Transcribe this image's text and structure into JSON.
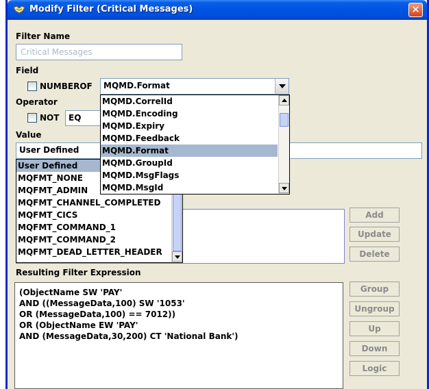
{
  "window": {
    "title": "Modify Filter (Critical Messages)",
    "close_glyph": "✕"
  },
  "filter_name": {
    "label": "Filter Name",
    "placeholder": "Critical Messages"
  },
  "field": {
    "label": "Field",
    "numberof_label": "NUMBEROF",
    "numberof_checked": false,
    "selected": "MQMD.Format",
    "options": [
      "MQMD.CorrelId",
      "MQMD.Encoding",
      "MQMD.Expiry",
      "MQMD.Feedback",
      "MQMD.Format",
      "MQMD.GroupId",
      "MQMD.MsgFlags",
      "MQMD.MsgId"
    ]
  },
  "operator": {
    "label": "Operator",
    "not_label": "NOT",
    "not_checked": false,
    "selected": "EQ"
  },
  "value": {
    "label": "Value",
    "selected": "User Defined",
    "input": "",
    "options": [
      "User Defined",
      "MQFMT_NONE",
      "MQFMT_ADMIN",
      "MQFMT_CHANNEL_COMPLETED",
      "MQFMT_CICS",
      "MQFMT_COMMAND_1",
      "MQFMT_COMMAND_2",
      "MQFMT_DEAD_LETTER_HEADER"
    ]
  },
  "side_buttons": {
    "add": "Add",
    "update": "Update",
    "delete": "Delete",
    "group": "Group",
    "ungroup": "Ungroup",
    "up": "Up",
    "down": "Down",
    "logic": "Logic"
  },
  "resulting": {
    "label": "Resulting Filter Expression",
    "lines": [
      "(ObjectName SW 'PAY'",
      "AND ((MessageData,100) SW '1053'",
      "OR (MessageData,100) == 7012))",
      "OR (ObjectName EW 'PAY'",
      "AND (MessageData,30,200) CT 'National Bank')"
    ]
  },
  "colors": {
    "titlebar": "#0054e3",
    "window_bg": "#ece9d8",
    "selection": "#a6b8d0",
    "border_blue": "#7f9db9"
  }
}
